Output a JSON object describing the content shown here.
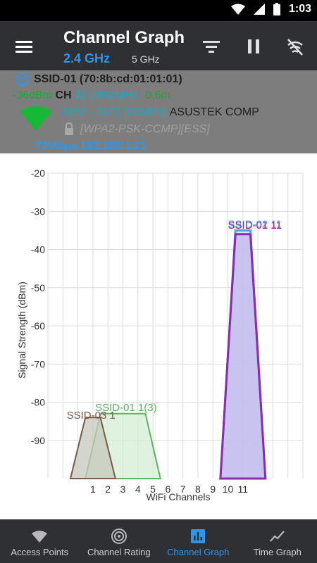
{
  "status_bar": {
    "time": "1:03"
  },
  "app_bar": {
    "title": "Channel Graph",
    "band_selected": "2.4 GHz",
    "band_other": "5 GHz"
  },
  "access_point": {
    "ssid_line": "SSID-01 (70:8b:cd:01:01:01)",
    "signal": "-36dBm",
    "ch_label": "CH",
    "channel": "11",
    "frequency": "2462MHz",
    "distance": "0.6m",
    "range": "2452 - 2472 (20MHz)",
    "vendor": "ASUSTEK COMP",
    "security": "[WPA2-PSK-CCMP][ESS]",
    "rate_ip": "72Mbps 192.168.1.21"
  },
  "chart_data": {
    "type": "area",
    "ylabel": "Signal Strength (dBm)",
    "xlabel": "WiFi Channels",
    "ylim": [
      -100,
      -20
    ],
    "yticks": [
      -20,
      -30,
      -40,
      -50,
      -60,
      -70,
      -80,
      -90
    ],
    "xlim": [
      -2,
      15
    ],
    "xticks": [
      "1",
      "2",
      "3",
      "4",
      "5",
      "6",
      "7",
      "8",
      "9",
      "10",
      "11"
    ],
    "grid": true,
    "series": [
      {
        "name": "SSID-01 1(3)",
        "center": 3,
        "width": 4,
        "signal": -83,
        "color": "#58b55b",
        "fill": "#d4ecd4"
      },
      {
        "name": "SSID-03 1",
        "center": 1,
        "width": 2,
        "signal": -84,
        "color": "#7a5a48",
        "fill": "#c6c8bc"
      },
      {
        "name": "SSID-02 11",
        "center": 11,
        "width": 2,
        "signal": -35,
        "color": "#4ba3de",
        "fill": "#cfd6f5"
      },
      {
        "name": "SSID-01 11",
        "center": 11,
        "width": 2,
        "signal": -36,
        "color": "#8c2bb0",
        "fill": "#c2b9ec"
      }
    ]
  },
  "bottom_nav": {
    "items": [
      {
        "label": "Access Points",
        "icon": "wifi-icon"
      },
      {
        "label": "Channel Rating",
        "icon": "radar-icon"
      },
      {
        "label": "Channel Graph",
        "icon": "bar-chart-icon"
      },
      {
        "label": "Time Graph",
        "icon": "line-chart-icon"
      }
    ]
  }
}
